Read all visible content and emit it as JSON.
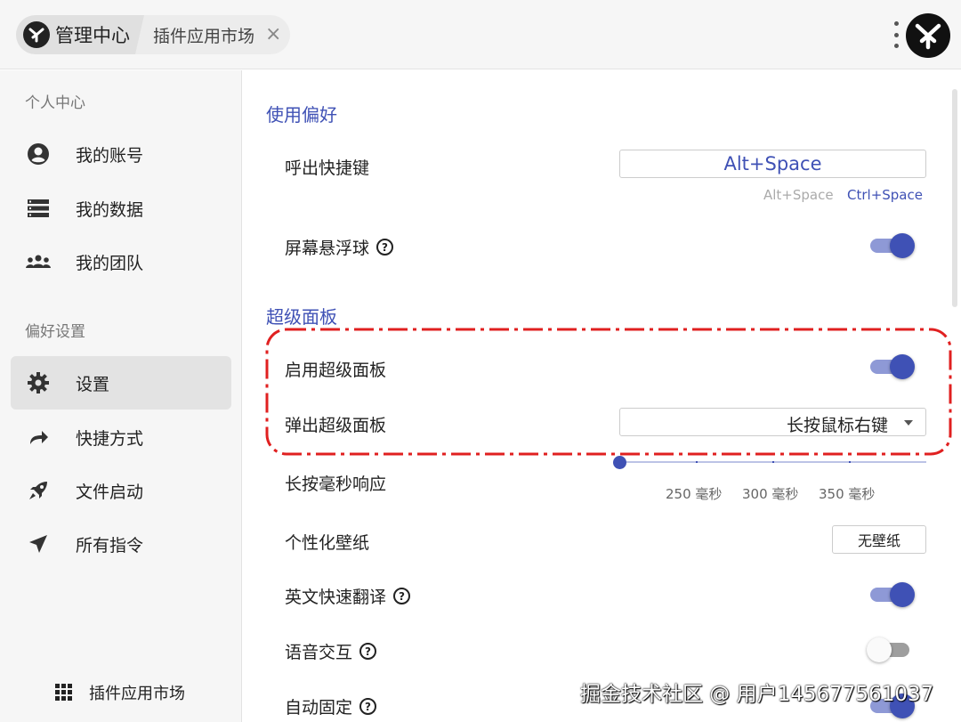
{
  "topbar": {
    "app_title": "管理中心",
    "tab_label": "插件应用市场",
    "tab_close": "×"
  },
  "sidebar": {
    "section_personal": "个人中心",
    "personal_items": [
      {
        "label": "我的账号",
        "icon": "account-circle-icon"
      },
      {
        "label": "我的数据",
        "icon": "data-list-icon"
      },
      {
        "label": "我的团队",
        "icon": "team-icon"
      }
    ],
    "section_prefs": "偏好设置",
    "pref_items": [
      {
        "label": "设置",
        "icon": "gear-icon",
        "active": true
      },
      {
        "label": "快捷方式",
        "icon": "shortcut-arrow-icon"
      },
      {
        "label": "文件启动",
        "icon": "rocket-icon"
      },
      {
        "label": "所有指令",
        "icon": "send-icon"
      }
    ],
    "plugin_market": "插件应用市场"
  },
  "main": {
    "group_usage": "使用偏好",
    "hotkey_label": "呼出快捷键",
    "hotkey_value": "Alt+Space",
    "hotkey_option_1": "Alt+Space",
    "hotkey_option_2": "Ctrl+Space",
    "floating_ball_label": "屏幕悬浮球",
    "floating_ball_on": true,
    "group_super": "超级面板",
    "enable_super_label": "启用超级面板",
    "enable_super_on": true,
    "popup_super_label": "弹出超级面板",
    "popup_super_value": "长按鼠标右键",
    "long_press_label": "长按毫秒响应",
    "slider_ticks": [
      "250 毫秒",
      "300 毫秒",
      "350 毫秒"
    ],
    "wallpaper_label": "个性化壁纸",
    "wallpaper_button": "无壁纸",
    "translate_label": "英文快速翻译",
    "translate_on": true,
    "voice_label": "语音交互",
    "voice_on": false,
    "autofix_label": "自动固定",
    "autofix_on": true,
    "help_glyph": "?"
  },
  "colors": {
    "accent": "#3f51b5",
    "highlight_border": "#e02020"
  },
  "watermark": "掘金技术社区 @ 用户14567756​1037"
}
